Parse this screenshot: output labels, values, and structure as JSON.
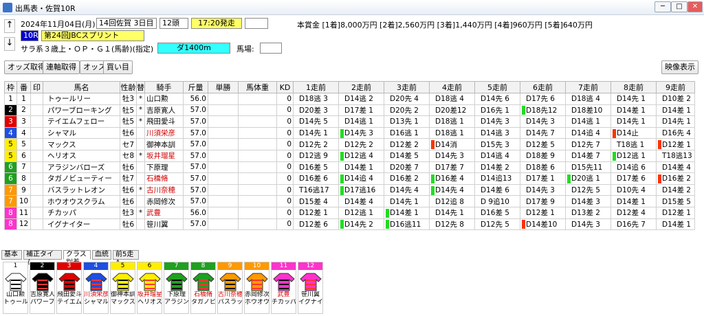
{
  "window": {
    "title": "出馬表・佐賀10R"
  },
  "header": {
    "date": "2024年11月04日(月)",
    "meeting": "14回佐賀 3日目",
    "runners": "12頭",
    "post_time": "17:20発走",
    "race_no": "10R",
    "race_name": "第24回JBCスプリント",
    "conditions": "サラ系３歳上・ＯＰ・Ｇ１(馬齢)(指定)",
    "course": "ダ1400m",
    "track_label": "馬場:",
    "prize": "本賞金 [1着]8,000万円 [2着]2,560万円 [3着]1,440万円 [4着]960万円 [5着]640万円"
  },
  "toolbar": {
    "odds_get": "オッズ取得",
    "renpuku_get": "連軸取得",
    "odds": "オッズ",
    "buy": "買い目",
    "video": "映像表示"
  },
  "columns": [
    "枠",
    "番",
    "印",
    "馬名",
    "性齢",
    "替",
    "騎手",
    "斤量",
    "単勝",
    "馬体重",
    "KD",
    "1走前",
    "2走前",
    "3走前",
    "4走前",
    "5走前",
    "6走前",
    "7走前",
    "8走前",
    "9走前"
  ],
  "frame_colors": {
    "1": "#ffffff",
    "2": "#000000",
    "3": "#e00000",
    "4": "#1f4fe0",
    "5": "#ffee00",
    "6": "#20a020",
    "7": "#ff9900",
    "8": "#ff33cc"
  },
  "rows": [
    {
      "waku": "1",
      "num": "1",
      "horse": "トゥールリー",
      "sex": "牡3",
      "chg": "*",
      "jockey": "山口勲",
      "red": false,
      "wt": "56.0",
      "kd": "0",
      "races": [
        "D18逃 3",
        "D14逃 2",
        "D20先 4",
        "D18逃 4",
        "D14先 6",
        "D17先 6",
        "D18逃 4",
        "D14先 1",
        "D10差 2"
      ],
      "marks": [
        "",
        "",
        "",
        "",
        "",
        "",
        "",
        "",
        ""
      ]
    },
    {
      "waku": "2",
      "num": "2",
      "horse": "パワーブローキング",
      "sex": "牡5",
      "chg": "*",
      "jockey": "吉原寛人",
      "red": false,
      "wt": "57.0",
      "kd": "0",
      "races": [
        "D20差 3",
        "D17差 1",
        "D20先 2",
        "D20差12",
        "D16先 1",
        "D18先12",
        "D18差10",
        "D14差 1",
        "D14差 1"
      ],
      "marks": [
        "",
        "",
        "",
        "",
        "",
        "g",
        "",
        "",
        ""
      ]
    },
    {
      "waku": "3",
      "num": "3",
      "horse": "テイエムフェロー",
      "sex": "牡5",
      "chg": "*",
      "jockey": "飛田愛斗",
      "red": false,
      "wt": "57.0",
      "kd": "0",
      "races": [
        "D14先 5",
        "D14逃 1",
        "D13先 1",
        "D18逃 1",
        "D14先 3",
        "D14先 3",
        "D14逃 1",
        "D14先 1",
        "D14先 1"
      ],
      "marks": [
        "",
        "",
        "",
        "",
        "",
        "",
        "",
        "",
        ""
      ]
    },
    {
      "waku": "4",
      "num": "4",
      "horse": "シャマル",
      "sex": "牡6",
      "chg": "",
      "jockey": "川須栄彦",
      "red": true,
      "wt": "57.0",
      "kd": "0",
      "races": [
        "D14先 1",
        "D14先 3",
        "D16逃 1",
        "D18逃 1",
        "D14逃 3",
        "D14先 7",
        "D14追 4",
        "D14止",
        "D16先 4"
      ],
      "marks": [
        "",
        "g",
        "",
        "",
        "",
        "",
        "",
        "r",
        ""
      ]
    },
    {
      "waku": "5",
      "num": "5",
      "horse": "マックス",
      "sex": "セ7",
      "chg": "",
      "jockey": "御神本訓",
      "red": false,
      "wt": "57.0",
      "kd": "0",
      "races": [
        "D12先 2",
        "D12先 2",
        "D12差 2",
        "D14消",
        "D15先 3",
        "D12差 5",
        "D12先 7",
        "T18逃 1",
        "D12差 1"
      ],
      "marks": [
        "",
        "",
        "",
        "r",
        "",
        "",
        "",
        "",
        "r"
      ]
    },
    {
      "waku": "5",
      "num": "6",
      "horse": "ヘリオス",
      "sex": "セ8",
      "chg": "*",
      "jockey": "坂井瑠星",
      "red": true,
      "wt": "57.0",
      "kd": "0",
      "races": [
        "D12逃 9",
        "D12逃 4",
        "D14差 5",
        "D14先 3",
        "D14逃 4",
        "D18差 9",
        "D14差 7",
        "D12逃 1",
        "T18逃13"
      ],
      "marks": [
        "",
        "g",
        "",
        "",
        "",
        "",
        "",
        "g",
        ""
      ]
    },
    {
      "waku": "6",
      "num": "7",
      "horse": "アラジンバローズ",
      "sex": "牡6",
      "chg": "",
      "jockey": "下原理",
      "red": false,
      "wt": "57.0",
      "kd": "0",
      "races": [
        "D16差 5",
        "D14差 1",
        "D20差 7",
        "D17差 7",
        "D14差 2",
        "D18差 6",
        "D15先11",
        "D14追 6",
        "D14差 4"
      ],
      "marks": [
        "",
        "",
        "",
        "",
        "",
        "",
        "",
        "",
        ""
      ]
    },
    {
      "waku": "6",
      "num": "8",
      "horse": "タガノビューティー",
      "sex": "牡7",
      "chg": "",
      "jockey": "石橋脩",
      "red": true,
      "wt": "57.0",
      "kd": "0",
      "races": [
        "D16差 6",
        "D14追 4",
        "D16差 2",
        "D16差 4",
        "D14追13",
        "D17差 1",
        "D20逃 1",
        "D17差 6",
        "D16差 2"
      ],
      "marks": [
        "",
        "g",
        "",
        "g",
        "",
        "",
        "g",
        "",
        "r"
      ]
    },
    {
      "waku": "7",
      "num": "9",
      "horse": "バスラットレオン",
      "sex": "牡6",
      "chg": "*",
      "jockey": "古川奈穂",
      "red": true,
      "wt": "57.0",
      "kd": "0",
      "races": [
        "T16逃17",
        "D17逃16",
        "D14先 4",
        "D14先 4",
        "D14差 6",
        "D14先 3",
        "D12先 5",
        "D10先 4",
        "D14差 2"
      ],
      "marks": [
        "",
        "g",
        "",
        "g",
        "",
        "",
        "",
        "",
        ""
      ]
    },
    {
      "waku": "7",
      "num": "10",
      "horse": "ホウオウスクラム",
      "sex": "牡6",
      "chg": "",
      "jockey": "赤岡修次",
      "red": false,
      "wt": "57.0",
      "kd": "0",
      "races": [
        "D15差 4",
        "D14差 4",
        "D14先 1",
        "D12追 8",
        "D 9追10",
        "D17差 9",
        "D14差 3",
        "D14差 1",
        "D15差 5"
      ],
      "marks": [
        "",
        "",
        "",
        "",
        "",
        "",
        "",
        "",
        ""
      ]
    },
    {
      "waku": "8",
      "num": "11",
      "horse": "チカッパ",
      "sex": "牡3",
      "chg": "*",
      "jockey": "武豊",
      "red": true,
      "wt": "56.0",
      "kd": "0",
      "races": [
        "D12差 1",
        "D12逃 1",
        "D14差 1",
        "D14先 1",
        "D16差 5",
        "D12差 1",
        "D13差 2",
        "D12差 4",
        "D12差 1"
      ],
      "marks": [
        "",
        "",
        "g",
        "",
        "",
        "",
        "",
        "",
        ""
      ]
    },
    {
      "waku": "8",
      "num": "12",
      "horse": "イグナイター",
      "sex": "牡6",
      "chg": "",
      "jockey": "笹川翼",
      "red": false,
      "wt": "57.0",
      "kd": "0",
      "races": [
        "D12差 6",
        "D14先 2",
        "D16逃11",
        "D12先 8",
        "D12先 5",
        "D14差10",
        "D14先 3",
        "D16先 7",
        "D14差 1"
      ],
      "marks": [
        "",
        "g",
        "g",
        "",
        "",
        "r",
        "",
        "",
        ""
      ]
    }
  ],
  "bottom_tabs": [
    "基本",
    "補正タイム",
    "クラス別着",
    "血統",
    "前5走A"
  ],
  "silks": [
    {
      "num": "1",
      "jockey": "山口勲",
      "horse": "トゥールリ",
      "red": false,
      "bg": "#ffffff",
      "fg": "#000000"
    },
    {
      "num": "2",
      "jockey": "吉原寛人",
      "horse": "パワーブロ",
      "red": false,
      "bg": "#000000",
      "fg": "#ffffff"
    },
    {
      "num": "3",
      "jockey": "飛田愛斗",
      "horse": "テイエムフ",
      "red": false,
      "bg": "#e00000",
      "fg": "#ffffff"
    },
    {
      "num": "4",
      "jockey": "川須栄彦",
      "horse": "シャマル",
      "red": true,
      "bg": "#1f4fe0",
      "fg": "#ffffff"
    },
    {
      "num": "5",
      "jockey": "御神本訓",
      "horse": "マックス",
      "red": false,
      "bg": "#ffee00",
      "fg": "#000000"
    },
    {
      "num": "6",
      "jockey": "坂井瑠星",
      "horse": "ヘリオス",
      "red": true,
      "bg": "#ffee00",
      "fg": "#000000"
    },
    {
      "num": "7",
      "jockey": "下原理",
      "horse": "アラジンバ",
      "red": false,
      "bg": "#20a020",
      "fg": "#ffffff"
    },
    {
      "num": "8",
      "jockey": "石橋脩",
      "horse": "タガノビュ",
      "red": true,
      "bg": "#20a020",
      "fg": "#ffffff"
    },
    {
      "num": "9",
      "jockey": "古川奈穂",
      "horse": "バスラット",
      "red": true,
      "bg": "#ff9900",
      "fg": "#ffffff"
    },
    {
      "num": "10",
      "jockey": "赤岡修次",
      "horse": "ホウオウス",
      "red": false,
      "bg": "#ff9900",
      "fg": "#ffffff"
    },
    {
      "num": "11",
      "jockey": "武豊",
      "horse": "チカッパ",
      "red": true,
      "bg": "#ff33cc",
      "fg": "#ffffff"
    },
    {
      "num": "12",
      "jockey": "笹川翼",
      "horse": "イグナイタ",
      "red": false,
      "bg": "#ff33cc",
      "fg": "#ffffff"
    }
  ]
}
